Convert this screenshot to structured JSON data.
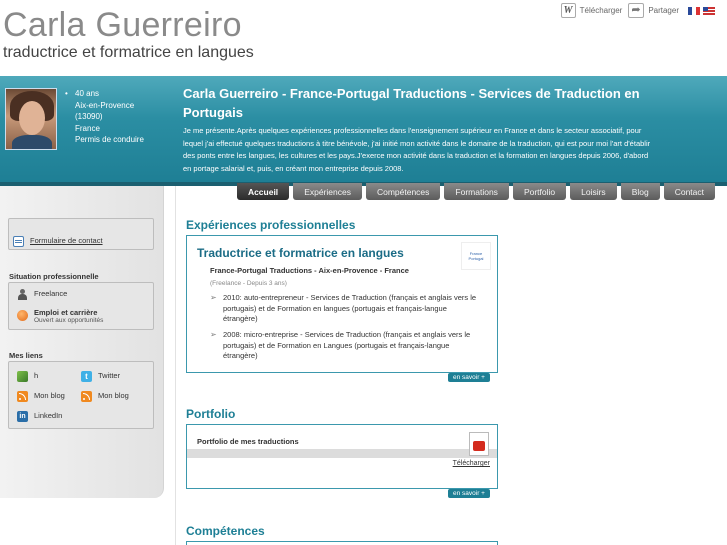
{
  "header": {
    "name": "Carla Guerreiro",
    "tagline": "traductrice et formatrice en langues"
  },
  "top_actions": {
    "download_label": "Télécharger",
    "share_label": "Partager",
    "flags": [
      "fr",
      "uk"
    ]
  },
  "profile": {
    "age": "40 ans",
    "city": "Aix-en-Provence",
    "postcode": "(13090)",
    "country": "France",
    "license": "Permis de conduire"
  },
  "banner": {
    "title": "Carla Guerreiro - France-Portugal Traductions - Services de Traduction en Portugais",
    "intro": "Je me présente.Après quelques expériences professionnelles dans l'enseignement supérieur en France et dans le secteur associatif, pour lequel j'ai effectué quelques traductions à titre bénévole, j'ai initié mon activité dans le domaine de la traduction, qui est pour moi l'art d'établir des ponts entre les langues, les cultures et les pays.J'exerce mon activité dans la traduction et la formation en langues depuis 2006, d'abord en portage salarial et, puis, en créant mon entreprise depuis 2008."
  },
  "nav": {
    "tabs": [
      "Accueil",
      "Expériences",
      "Compétences",
      "Formations",
      "Portfolio",
      "Loisirs",
      "Blog",
      "Contact"
    ],
    "active": "Accueil"
  },
  "sidebar": {
    "contact_link": "Formulaire de contact",
    "situation_heading": "Situation professionnelle",
    "situation_status": "Freelance",
    "situation_job_title": "Emploi et carrière",
    "situation_job_sub": "Ouvert aux opportunités",
    "links_heading": "Mes liens",
    "links": [
      "h",
      "Twitter",
      "Mon blog",
      "Mon blog",
      "LinkedIn"
    ]
  },
  "experiences": {
    "section_title": "Expériences professionnelles",
    "job_title": "Traductrice et formatrice en langues",
    "company": "France-Portugal Traductions - Aix-en-Provence - France",
    "company_meta": "(Freelance - Depuis 3 ans)",
    "items": [
      "2010: auto-entrepreneur - Services de Traduction (français et anglais vers le portugais) et de Formation en langues (portugais et français-langue étrangère)",
      "2008: micro-entreprise - Services de Traduction (français et anglais vers le portugais) et de Formation en Langues (portugais et français-langue étrangère)"
    ],
    "more": "en savoir +"
  },
  "portfolio": {
    "section_title": "Portfolio",
    "item_title": "Portfolio de mes traductions",
    "download": "Télécharger",
    "more": "en savoir +"
  },
  "competences": {
    "section_title": "Compétences"
  },
  "colors": {
    "accent": "#1e7f95",
    "banner": "#2b8ea3",
    "nav_tab": "#6a6a6a"
  }
}
